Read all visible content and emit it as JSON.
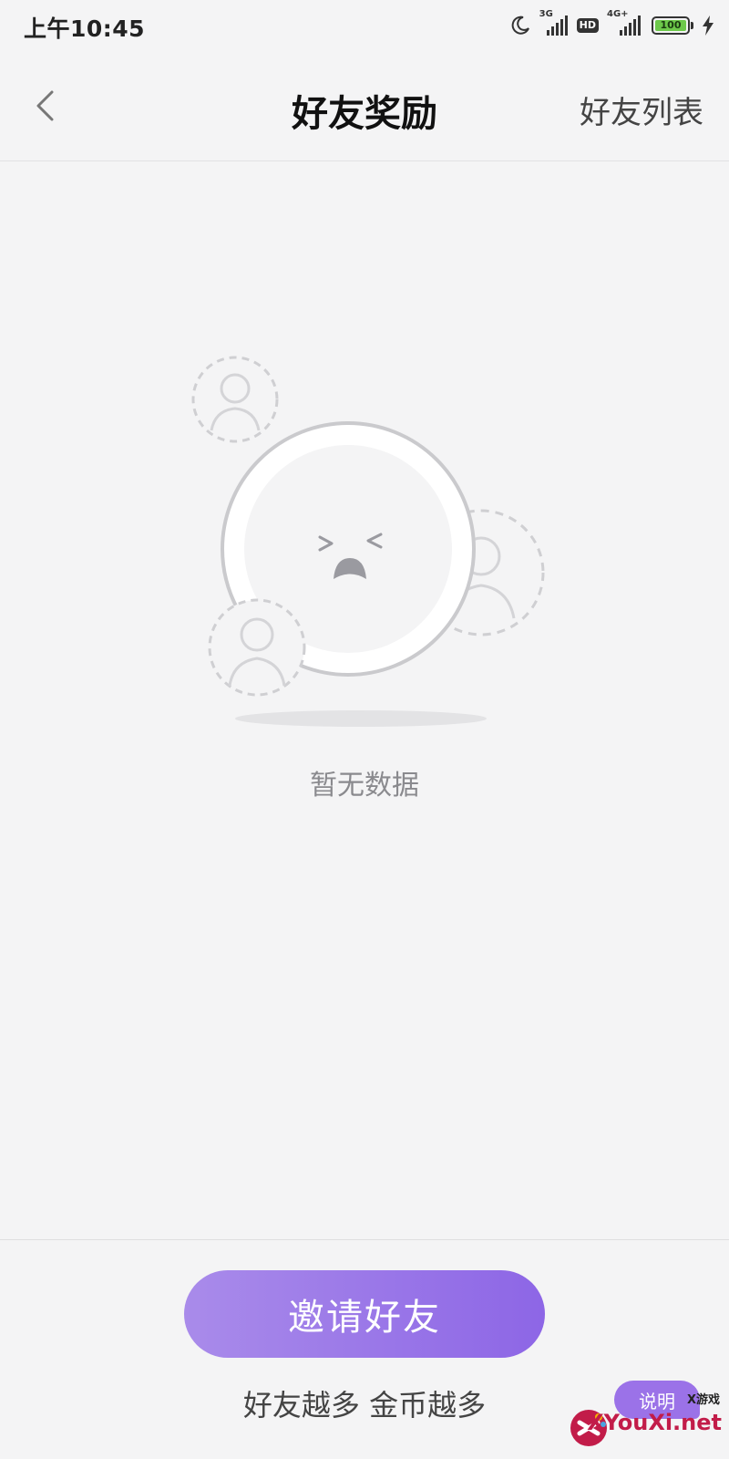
{
  "status_bar": {
    "time": "上午10:45",
    "network_1": "3G",
    "hd": "HD",
    "network_2": "4G+",
    "battery": "100"
  },
  "header": {
    "title": "好友奖励",
    "right_action": "好友列表"
  },
  "empty_state": {
    "text": "暂无数据"
  },
  "footer": {
    "invite_button": "邀请好友",
    "slogan": "好友越多 金币越多",
    "help_button": "说明"
  },
  "watermark": {
    "small": "X游戏",
    "main": "XYouXi.net"
  },
  "colors": {
    "accent_start": "#a98bea",
    "accent_end": "#8d66e6",
    "background": "#f4f4f5",
    "watermark_red": "#c21c49"
  },
  "icons": {
    "back": "chevron-left-icon",
    "moon": "moon-icon",
    "signal": "signal-icon",
    "charging": "lightning-icon"
  }
}
